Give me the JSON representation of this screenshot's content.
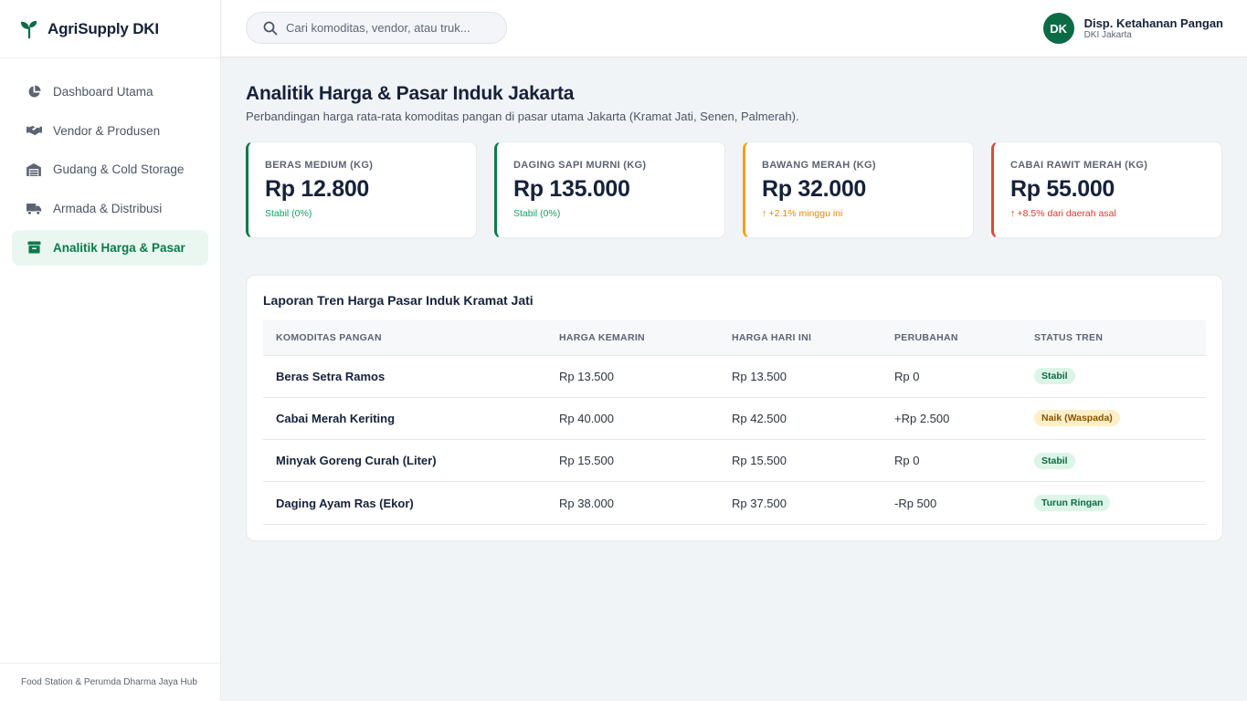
{
  "brand": {
    "name": "AgriSupply DKI",
    "color": "#0b6b45"
  },
  "sidebar": {
    "items": [
      {
        "label": "Dashboard Utama",
        "icon": "pie-chart-icon",
        "active": false
      },
      {
        "label": "Vendor & Produsen",
        "icon": "handshake-icon",
        "active": false
      },
      {
        "label": "Gudang & Cold Storage",
        "icon": "warehouse-icon",
        "active": false
      },
      {
        "label": "Armada & Distribusi",
        "icon": "truck-icon",
        "active": false
      },
      {
        "label": "Analitik Harga & Pasar",
        "icon": "store-icon",
        "active": true
      }
    ],
    "footer": "Food Station & Perumda Dharma Jaya Hub"
  },
  "topbar": {
    "search_placeholder": "Cari komoditas, vendor, atau truk...",
    "user": {
      "initials": "DK",
      "name": "Disp. Ketahanan Pangan",
      "subtitle": "DKI Jakarta"
    }
  },
  "page": {
    "title": "Analitik Harga & Pasar Induk Jakarta",
    "subtitle": "Perbandingan harga rata-rata komoditas pangan di pasar utama Jakarta (Kramat Jati, Senen, Palmerah)."
  },
  "cards": [
    {
      "label": "BERAS MEDIUM (KG)",
      "value": "Rp 12.800",
      "change": "Stabil (0%)",
      "trend": "stable",
      "accent": "#0b7a4b",
      "change_color": "#10a35f"
    },
    {
      "label": "DAGING SAPI MURNI (KG)",
      "value": "Rp 135.000",
      "change": "Stabil (0%)",
      "trend": "stable",
      "accent": "#0b7a4b",
      "change_color": "#10a35f"
    },
    {
      "label": "BAWANG MERAH (KG)",
      "value": "Rp 32.000",
      "change": "+2.1% minggu ini",
      "trend": "up",
      "accent": "#f2a01b",
      "change_color": "#e58a00"
    },
    {
      "label": "CABAI RAWIT MERAH (KG)",
      "value": "Rp 55.000",
      "change": "+8.5% dari daerah asal",
      "trend": "up",
      "accent": "#e2453c",
      "change_color": "#d63a31"
    }
  ],
  "report": {
    "title": "Laporan Tren Harga Pasar Induk Kramat Jati",
    "columns": [
      "KOMODITAS PANGAN",
      "HARGA KEMARIN",
      "HARGA HARI INI",
      "PERUBAHAN",
      "STATUS TREN"
    ],
    "rows": [
      {
        "name": "Beras Setra Ramos",
        "yesterday": "Rp 13.500",
        "today": "Rp 13.500",
        "change": "Rp 0",
        "status": "Stabil",
        "status_type": "green"
      },
      {
        "name": "Cabai Merah Keriting",
        "yesterday": "Rp 40.000",
        "today": "Rp 42.500",
        "change": "+Rp 2.500",
        "status": "Naik (Waspada)",
        "status_type": "amber"
      },
      {
        "name": "Minyak Goreng Curah (Liter)",
        "yesterday": "Rp 15.500",
        "today": "Rp 15.500",
        "change": "Rp 0",
        "status": "Stabil",
        "status_type": "green"
      },
      {
        "name": "Daging Ayam Ras (Ekor)",
        "yesterday": "Rp 38.000",
        "today": "Rp 37.500",
        "change": "-Rp 500",
        "status": "Turun Ringan",
        "status_type": "green"
      }
    ]
  }
}
